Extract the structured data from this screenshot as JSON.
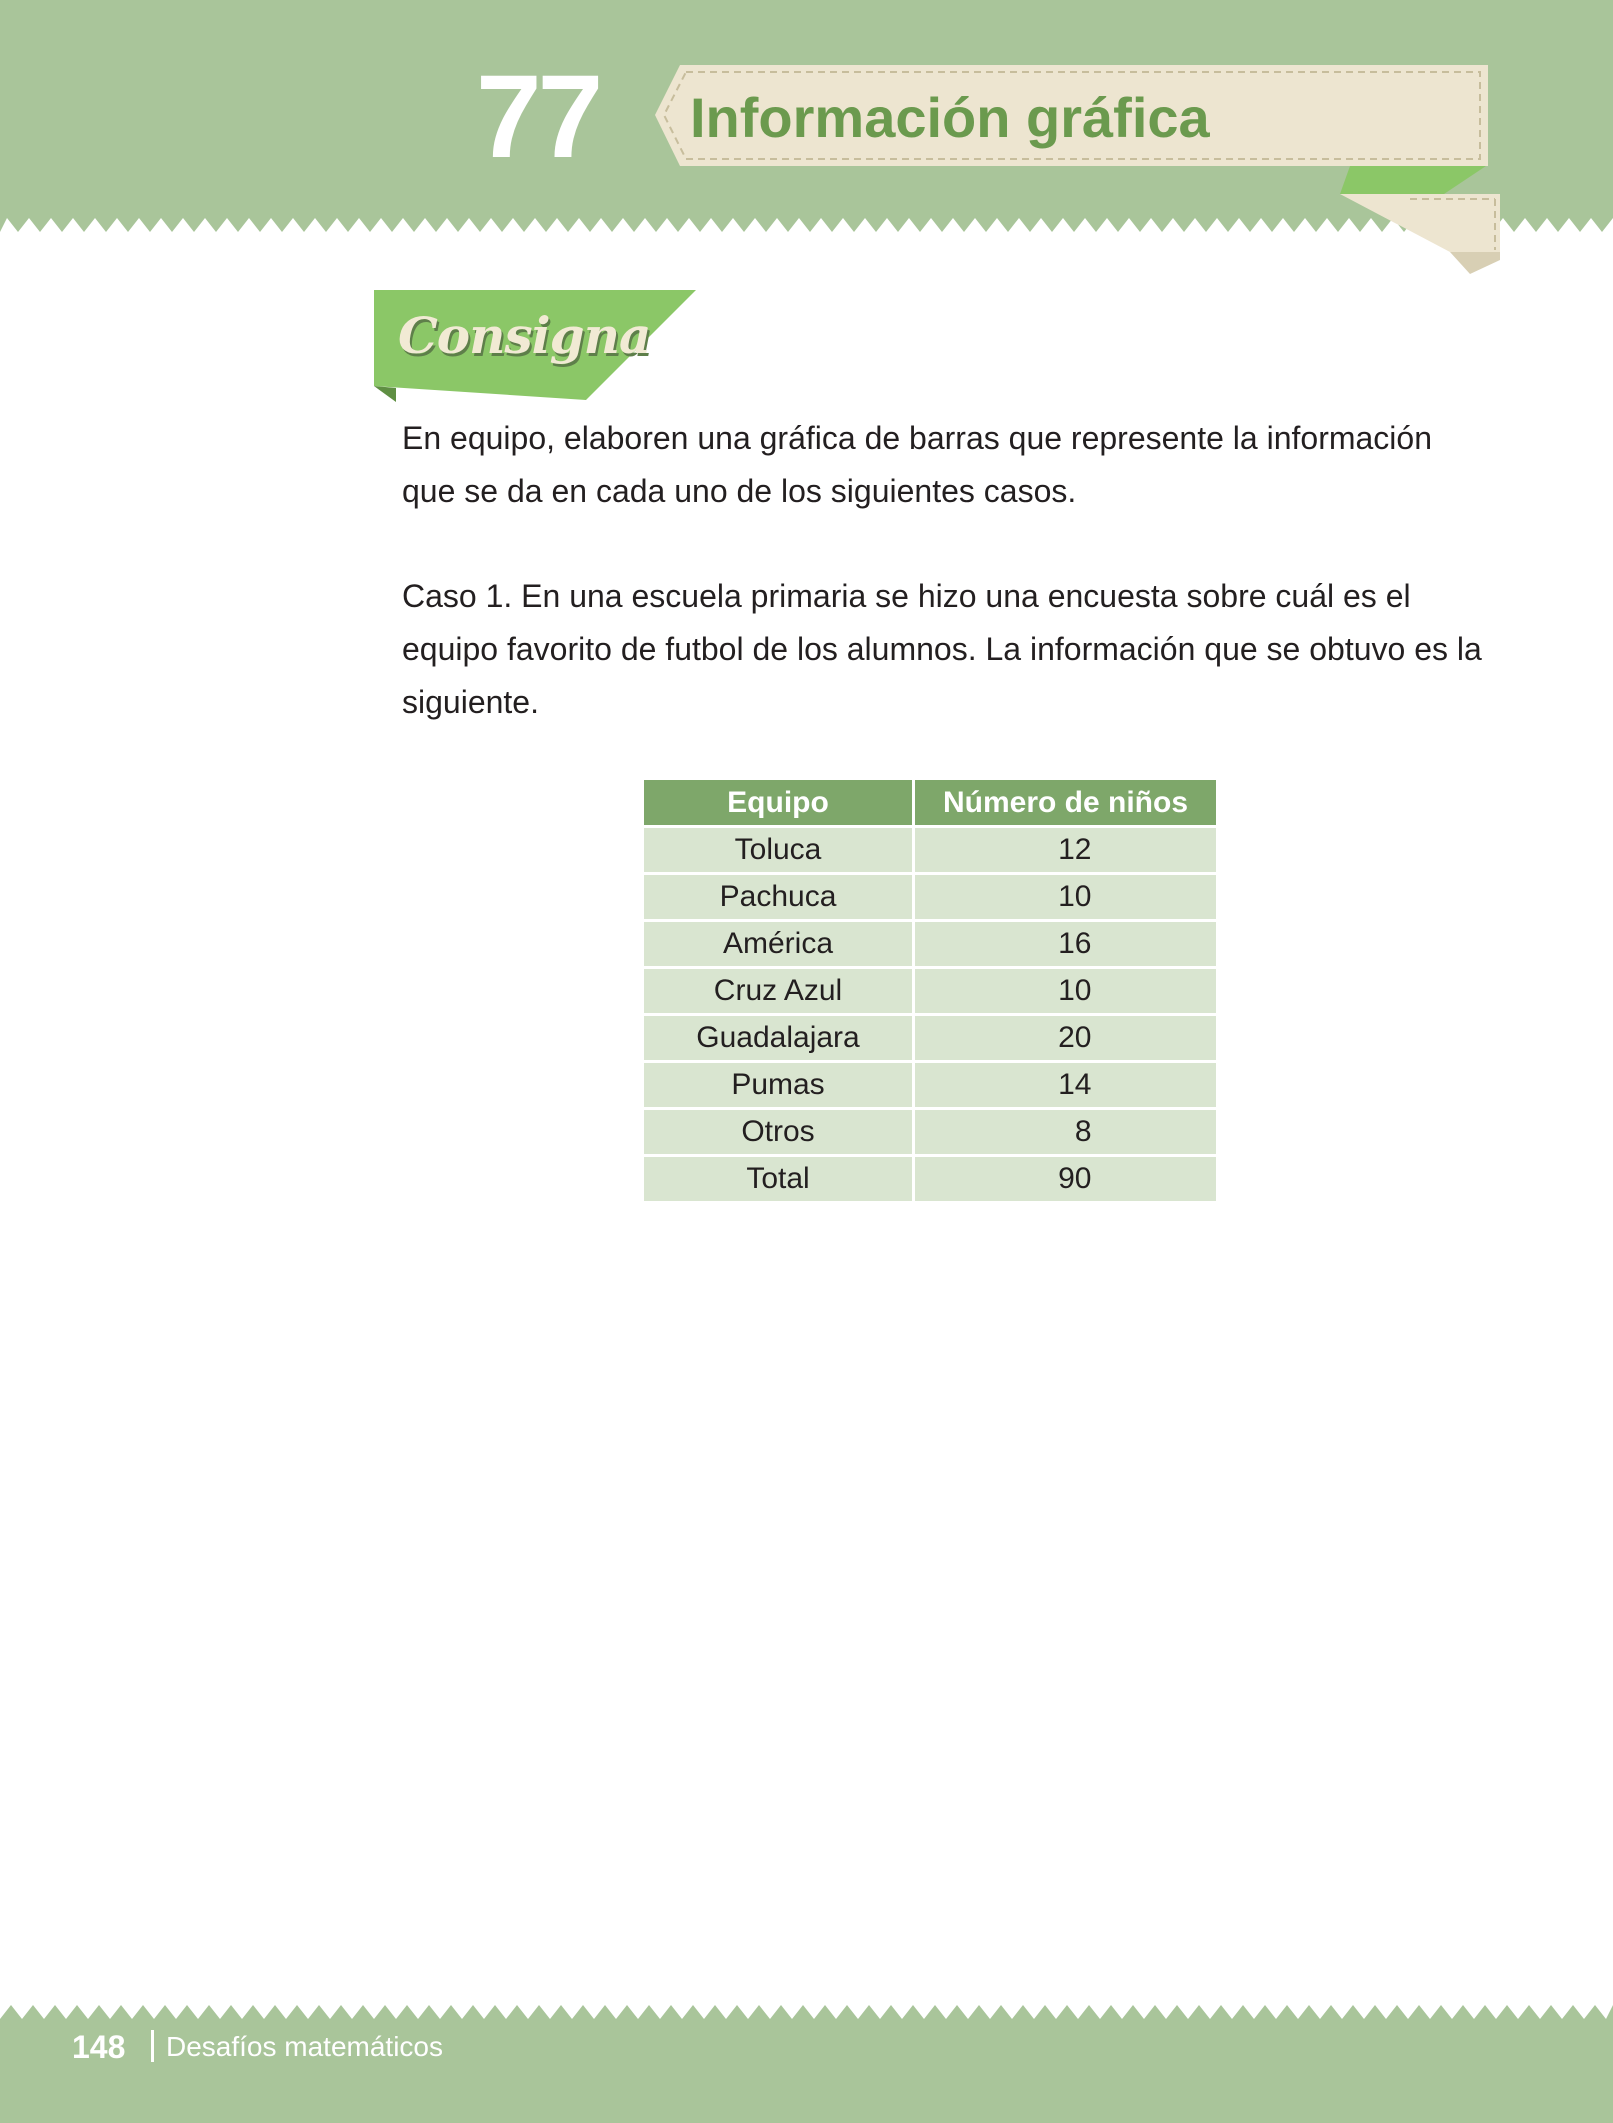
{
  "colors": {
    "band_green": "#a9c59a",
    "title_green": "#6b9a4e",
    "ribbon_cream": "#ede5d0",
    "tag_green": "#8bc767",
    "table_header": "#7ea76a",
    "table_cell": "#d9e5d0"
  },
  "header": {
    "lesson_number": "77",
    "lesson_title": "Información gráfica"
  },
  "consigna": {
    "label": "Consigna",
    "instruction": "En equipo, elaboren una gráfica de barras que represente la información que se da en cada uno de los siguientes casos.",
    "case1": "Caso 1. En una escuela primaria se hizo una encuesta sobre cuál es el equipo favorito de futbol de los alumnos. La información que se obtuvo es la siguiente."
  },
  "table": {
    "headers": [
      "Equipo",
      "Número de niños"
    ],
    "rows": [
      [
        "Toluca",
        "12"
      ],
      [
        "Pachuca",
        "10"
      ],
      [
        "América",
        "16"
      ],
      [
        "Cruz Azul",
        "10"
      ],
      [
        "Guadalajara",
        "20"
      ],
      [
        "Pumas",
        "14"
      ],
      [
        "Otros",
        "8"
      ],
      [
        "Total",
        "90"
      ]
    ]
  },
  "footer": {
    "page_number": "148",
    "book_title": "Desafíos matemáticos"
  }
}
